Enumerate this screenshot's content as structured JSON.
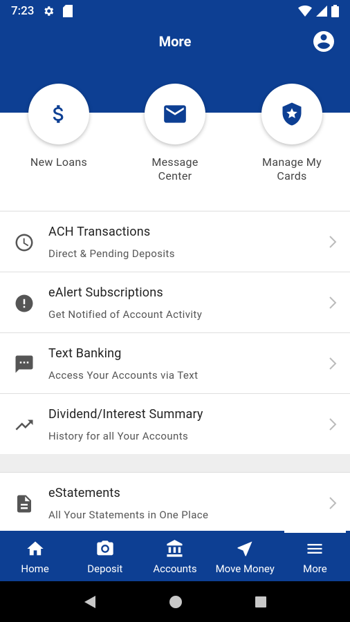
{
  "status": {
    "time": "7:23"
  },
  "header": {
    "title": "More"
  },
  "quick_actions": [
    {
      "label": "New Loans",
      "icon": "dollar-icon"
    },
    {
      "label": "Message\nCenter",
      "icon": "mail-icon"
    },
    {
      "label": "Manage My\nCards",
      "icon": "shield-star-icon"
    }
  ],
  "menu": [
    {
      "title": "ACH Transactions",
      "subtitle": "Direct & Pending Deposits",
      "icon": "clock-icon"
    },
    {
      "title": "eAlert Subscriptions",
      "subtitle": "Get Notified of Account Activity",
      "icon": "alert-icon"
    },
    {
      "title": "Text Banking",
      "subtitle": "Access Your Accounts via Text",
      "icon": "sms-icon"
    },
    {
      "title": "Dividend/Interest Summary",
      "subtitle": "History for all Your Accounts",
      "icon": "trending-up-icon"
    }
  ],
  "menu2": [
    {
      "title": "eStatements",
      "subtitle": "All Your Statements in One Place",
      "icon": "document-icon"
    }
  ],
  "nav": [
    {
      "label": "Home",
      "icon": "home-icon"
    },
    {
      "label": "Deposit",
      "icon": "camera-icon"
    },
    {
      "label": "Accounts",
      "icon": "bank-icon"
    },
    {
      "label": "Move Money",
      "icon": "navigation-icon"
    },
    {
      "label": "More",
      "icon": "menu-icon",
      "active": true
    }
  ],
  "colors": {
    "primary": "#0d3f93",
    "background": "#eeeeee"
  }
}
